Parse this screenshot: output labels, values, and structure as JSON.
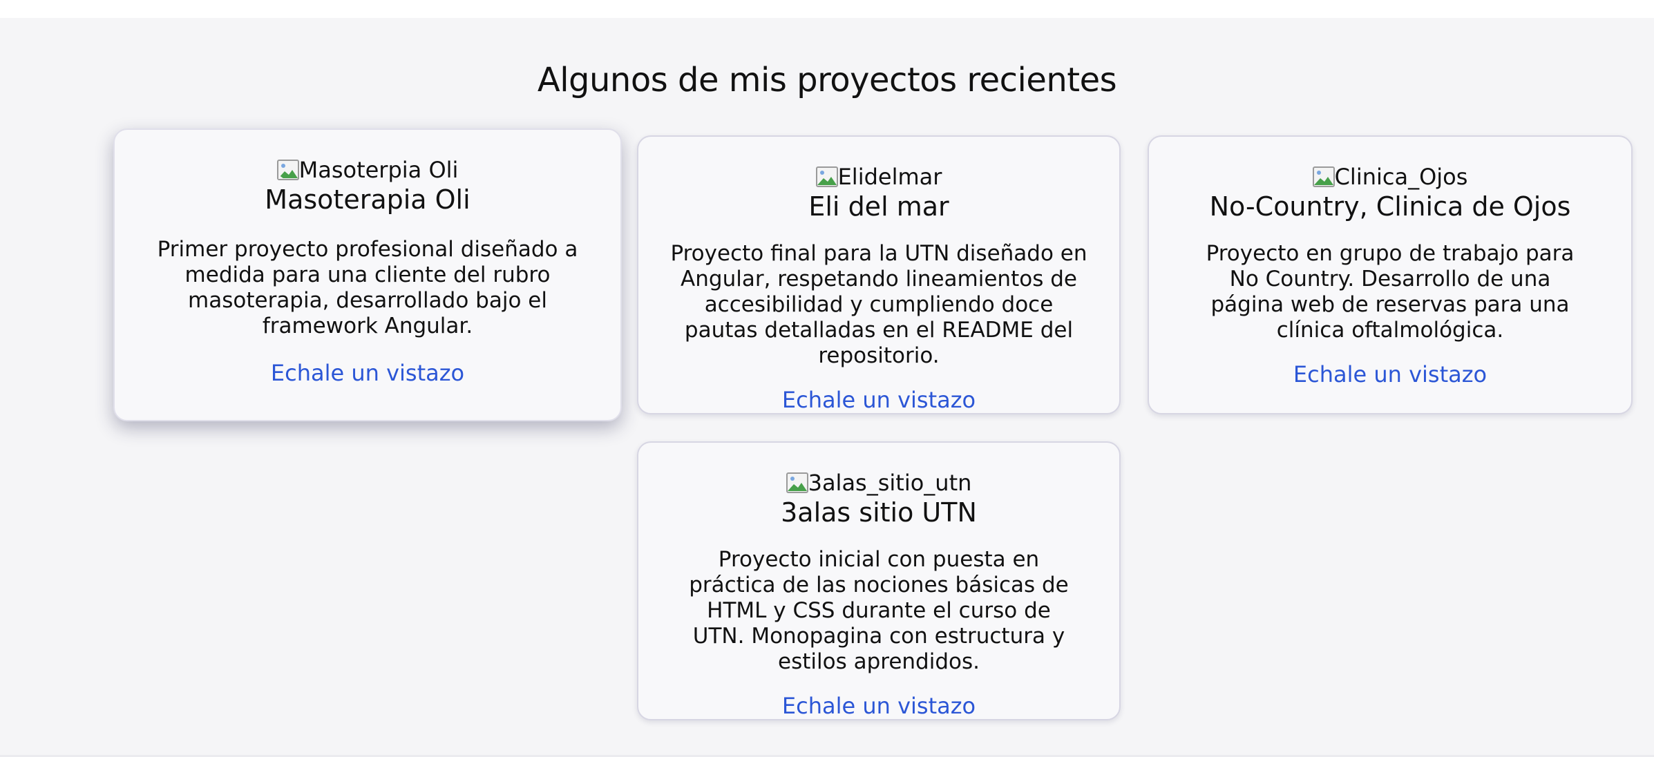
{
  "section": {
    "title": "Algunos de mis proyectos recientes"
  },
  "projects": [
    {
      "image_alt": "Masoterpia Oli",
      "title": "Masoterapia Oli",
      "description": "Primer proyecto profesional diseñado a medida para una cliente del rubro masoterapia, desarrollado bajo el framework Angular.",
      "link_label": "Echale un vistazo"
    },
    {
      "image_alt": "Elidelmar",
      "title": "Eli del mar",
      "description": "Proyecto final para la UTN diseñado en Angular, respetando lineamientos de accesibilidad y cumpliendo doce pautas detalladas en el README del repositorio.",
      "link_label": "Echale un vistazo"
    },
    {
      "image_alt": "Clinica_Ojos",
      "title": "No-Country, Clinica de Ojos",
      "description": "Proyecto en grupo de trabajo para No Country. Desarrollo de una página web de reservas para una clínica oftalmológica.",
      "link_label": "Echale un vistazo"
    },
    {
      "image_alt": "3alas_sitio_utn",
      "title": "3alas sitio UTN",
      "description": "Proyecto inicial con puesta en práctica de las nociones básicas de HTML y CSS durante el curso de UTN. Monopagina con estructura y estilos aprendidos.",
      "link_label": "Echale un vistazo"
    }
  ],
  "colors": {
    "link": "#2b56d6",
    "section_background": "#f5f5f7",
    "card_background": "#f8f8fa",
    "card_border": "#d7d6e3"
  },
  "icons": {
    "broken_image": "broken-image-icon"
  }
}
